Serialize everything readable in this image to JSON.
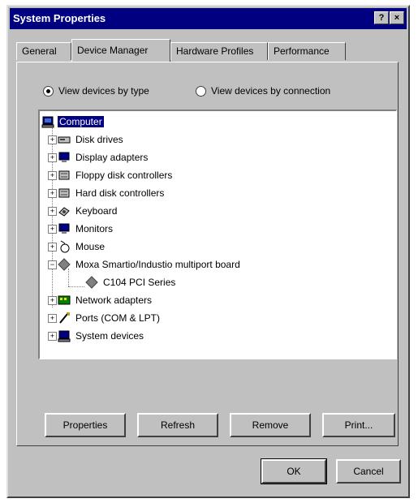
{
  "window": {
    "title": "System Properties",
    "help_glyph": "?",
    "close_glyph": "×"
  },
  "tabs": [
    {
      "label": "General"
    },
    {
      "label": "Device Manager",
      "active": true
    },
    {
      "label": "Hardware Profiles"
    },
    {
      "label": "Performance"
    }
  ],
  "view_options": {
    "by_type": {
      "label": "View devices by type",
      "selected": true
    },
    "by_connection": {
      "label": "View devices by connection",
      "selected": false
    }
  },
  "tree": {
    "root": {
      "label": "Computer",
      "icon": "computer-icon"
    },
    "items": [
      {
        "label": "Disk drives",
        "icon": "disk-drive-icon",
        "expander": "+"
      },
      {
        "label": "Display adapters",
        "icon": "display-adapter-icon",
        "expander": "+"
      },
      {
        "label": "Floppy disk controllers",
        "icon": "floppy-controller-icon",
        "expander": "+"
      },
      {
        "label": "Hard disk controllers",
        "icon": "hard-disk-controller-icon",
        "expander": "+"
      },
      {
        "label": "Keyboard",
        "icon": "keyboard-icon",
        "expander": "+"
      },
      {
        "label": "Monitors",
        "icon": "monitor-icon",
        "expander": "+"
      },
      {
        "label": "Mouse",
        "icon": "mouse-icon",
        "expander": "+"
      },
      {
        "label": "Moxa Smartio/Industio multiport board",
        "icon": "multiport-board-icon",
        "expander": "−",
        "children": [
          {
            "label": "C104 PCI Series",
            "icon": "multiport-board-icon"
          }
        ]
      },
      {
        "label": "Network adapters",
        "icon": "network-adapter-icon",
        "expander": "+"
      },
      {
        "label": "Ports (COM & LPT)",
        "icon": "port-icon",
        "expander": "+"
      },
      {
        "label": "System devices",
        "icon": "system-device-icon",
        "expander": "+"
      }
    ]
  },
  "actions": {
    "properties": "Properties",
    "refresh": "Refresh",
    "remove": "Remove",
    "print": "Print..."
  },
  "dialog": {
    "ok": "OK",
    "cancel": "Cancel"
  },
  "colors": {
    "face": "#c0c0c0",
    "title_bar": "#000080",
    "selection": "#000080"
  }
}
